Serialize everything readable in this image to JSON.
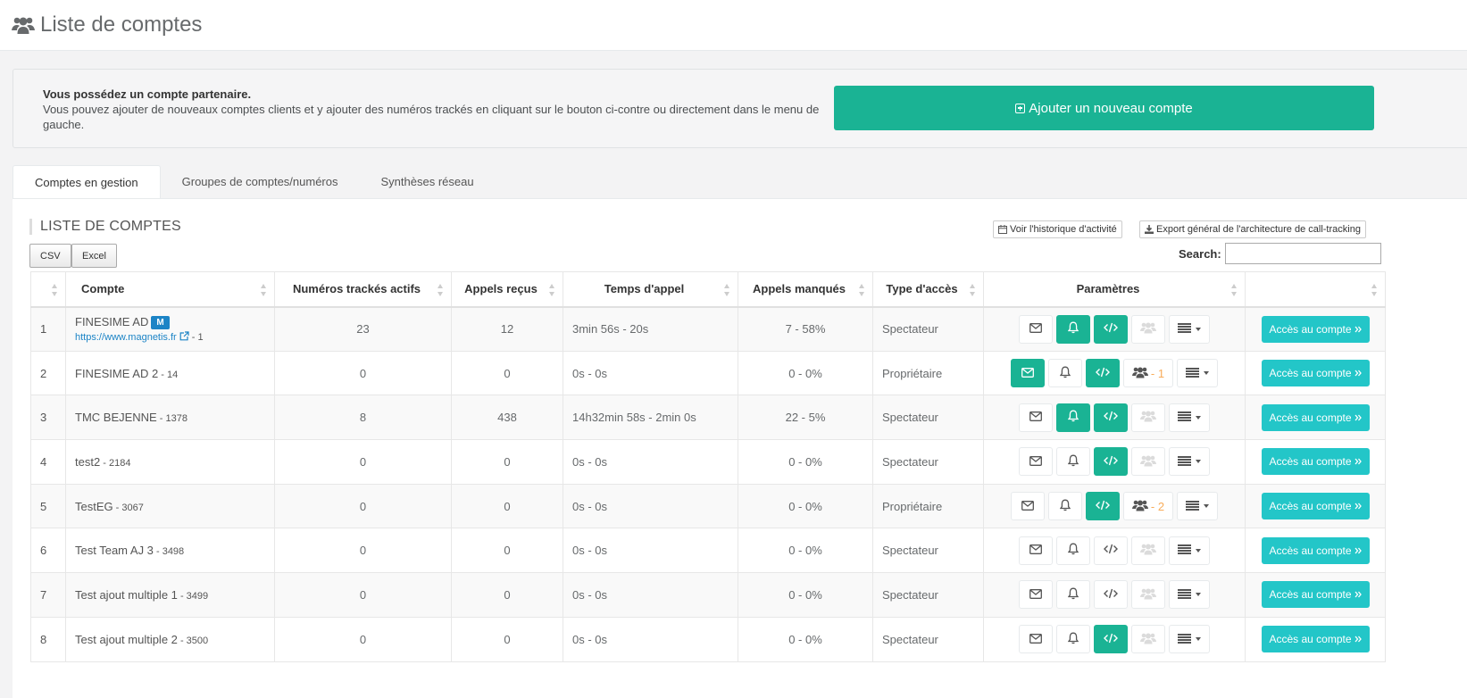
{
  "header": {
    "title": "Liste de comptes",
    "icon": "users-icon"
  },
  "partner": {
    "title": "Vous possédez un compte partenaire.",
    "text": "Vous pouvez ajouter de nouveaux comptes clients et y ajouter des numéros trackés en cliquant sur le bouton ci-contre ou directement dans le menu de gauche.",
    "add_button": "Ajouter un nouveau compte"
  },
  "tabs": [
    {
      "label": "Comptes en gestion",
      "active": true
    },
    {
      "label": "Groupes de comptes/numéros",
      "active": false
    },
    {
      "label": "Synthèses réseau",
      "active": false
    }
  ],
  "list": {
    "title": "LISTE DE COMPTES",
    "history_button": "Voir l'historique d'activité",
    "export_button": "Export général de l'architecture de call-tracking",
    "csv_button": "CSV",
    "excel_button": "Excel",
    "search_label": "Search:",
    "search_value": ""
  },
  "columns": [
    "",
    "Compte",
    "Numéros trackés actifs",
    "Appels reçus",
    "Temps d'appel",
    "Appels manqués",
    "Type d'accès",
    "Paramètres",
    ""
  ],
  "access_label": "Accès au compte",
  "rows": [
    {
      "idx": "1",
      "name": "FINESIME AD",
      "badge": "M",
      "link": "https://www.magnetis.fr",
      "id": " - 1",
      "tracked": "23",
      "calls": "12",
      "time": "3min 56s - 20s",
      "missed": "7 - 58%",
      "type": "Spectateur",
      "mail": false,
      "bell": true,
      "code": true,
      "group": null
    },
    {
      "idx": "2",
      "name": "FINESIME AD 2",
      "id": " - 14",
      "tracked": "0",
      "calls": "0",
      "time": "0s - 0s",
      "missed": "0 - 0%",
      "type": "Propriétaire",
      "mail": true,
      "bell": false,
      "code": true,
      "group": " - 1"
    },
    {
      "idx": "3",
      "name": "TMC BEJENNE",
      "id": " - 1378",
      "tracked": "8",
      "calls": "438",
      "time": "14h32min 58s - 2min 0s",
      "missed": "22 - 5%",
      "type": "Spectateur",
      "mail": false,
      "bell": true,
      "code": true,
      "group": null
    },
    {
      "idx": "4",
      "name": "test2",
      "id": " - 2184",
      "tracked": "0",
      "calls": "0",
      "time": "0s - 0s",
      "missed": "0 - 0%",
      "type": "Spectateur",
      "mail": false,
      "bell": false,
      "code": true,
      "group": null
    },
    {
      "idx": "5",
      "name": "TestEG",
      "id": " - 3067",
      "tracked": "0",
      "calls": "0",
      "time": "0s - 0s",
      "missed": "0 - 0%",
      "type": "Propriétaire",
      "mail": false,
      "bell": false,
      "code": true,
      "group": " - 2"
    },
    {
      "idx": "6",
      "name": "Test Team AJ 3",
      "id": " - 3498",
      "tracked": "0",
      "calls": "0",
      "time": "0s - 0s",
      "missed": "0 - 0%",
      "type": "Spectateur",
      "mail": false,
      "bell": false,
      "code": false,
      "group": null
    },
    {
      "idx": "7",
      "name": "Test ajout multiple 1",
      "id": " - 3499",
      "tracked": "0",
      "calls": "0",
      "time": "0s - 0s",
      "missed": "0 - 0%",
      "type": "Spectateur",
      "mail": false,
      "bell": false,
      "code": false,
      "group": null
    },
    {
      "idx": "8",
      "name": "Test ajout multiple 2",
      "id": " - 3500",
      "tracked": "0",
      "calls": "0",
      "time": "0s - 0s",
      "missed": "0 - 0%",
      "type": "Spectateur",
      "mail": false,
      "bell": false,
      "code": true,
      "group": null
    }
  ],
  "colors": {
    "primary": "#1ab394",
    "info": "#23c6c8",
    "badge": "#1c84c6",
    "warning": "#f8ac59"
  }
}
